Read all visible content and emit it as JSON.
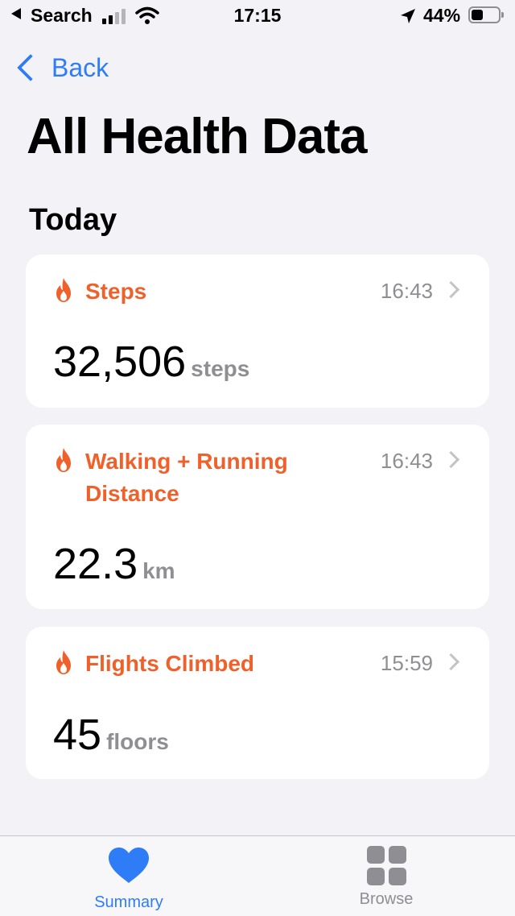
{
  "status_bar": {
    "back_app": "Search",
    "time": "17:15",
    "battery_percent": "44%",
    "battery_level": 0.44,
    "signal_bars": 2
  },
  "nav": {
    "back_label": "Back"
  },
  "page": {
    "title": "All Health Data",
    "section": "Today"
  },
  "cards": [
    {
      "name": "Steps",
      "time": "16:43",
      "value": "32,506",
      "unit": "steps",
      "icon": "flame-icon"
    },
    {
      "name": "Walking + Running Distance",
      "time": "16:43",
      "value": "22.3",
      "unit": "km",
      "icon": "flame-icon"
    },
    {
      "name": "Flights Climbed",
      "time": "15:59",
      "value": "45",
      "unit": "floors",
      "icon": "flame-icon"
    }
  ],
  "tabbar": {
    "summary_label": "Summary",
    "browse_label": "Browse",
    "active": "summary"
  },
  "colors": {
    "accent": "#2e7cf6",
    "metric": "#f0602b",
    "background": "#f2f2f7"
  }
}
